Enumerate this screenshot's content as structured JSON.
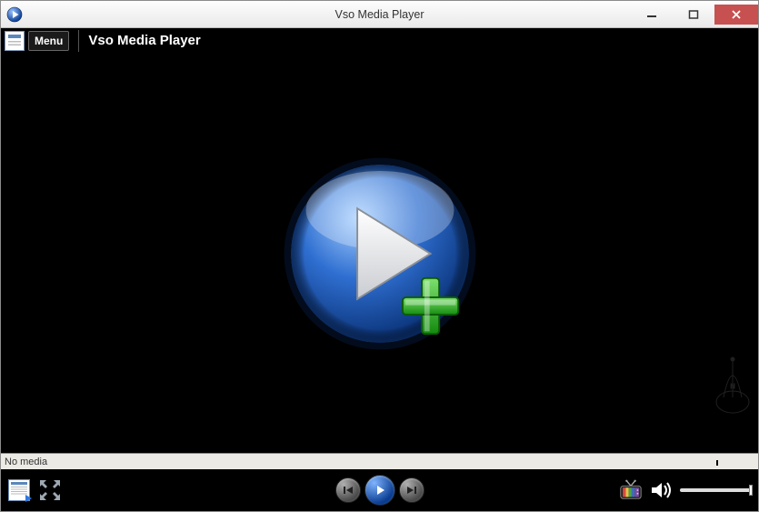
{
  "window": {
    "title": "Vso Media Player"
  },
  "menubar": {
    "menu_label": "Menu",
    "app_name": "Vso Media Player"
  },
  "status": {
    "text": "No media"
  },
  "controls": {
    "playlist": "Playlist",
    "fullscreen": "Fullscreen",
    "previous": "Previous",
    "play": "Play",
    "next": "Next",
    "tv": "TV Channels",
    "volume": "Volume"
  },
  "center": {
    "open_label": "Open / Play"
  }
}
